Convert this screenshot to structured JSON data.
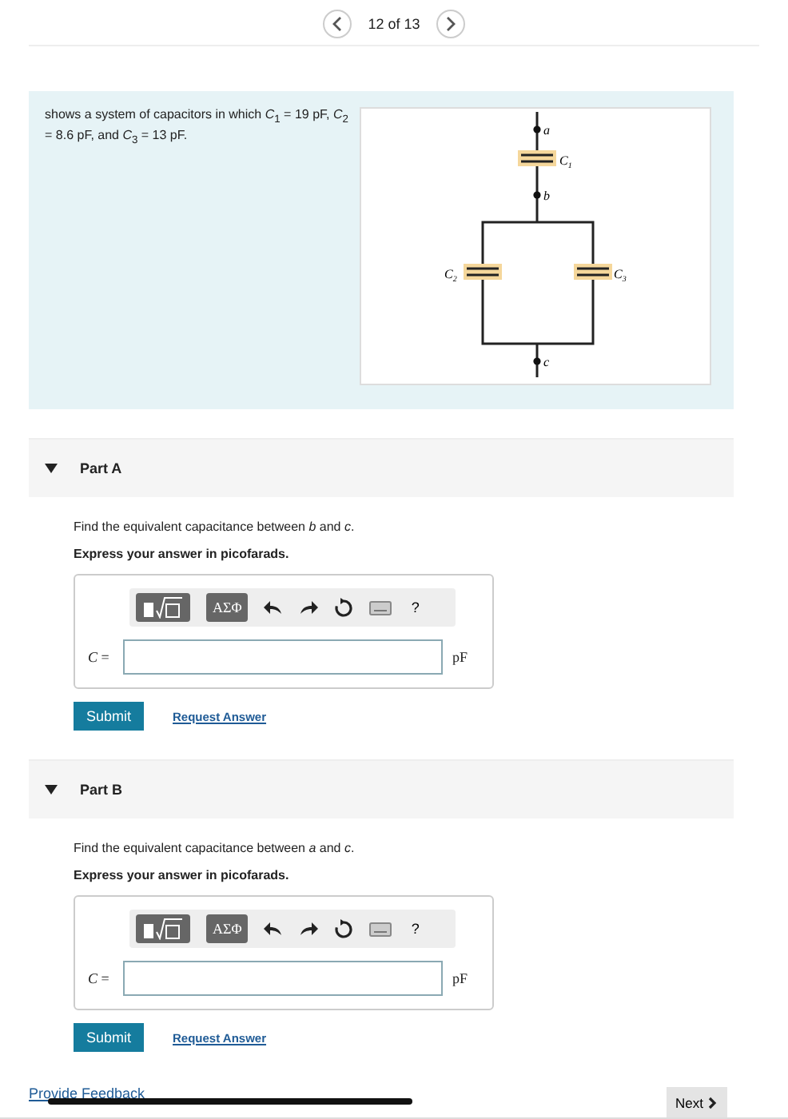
{
  "pager": {
    "label": "12 of 13"
  },
  "intro": {
    "text": "shows a system of capacitors in which *C*$_{1}$ = 19 pF, *C*$_{2}$ = 8.6 pF, and *C*$_{3}$ = 13 pF.",
    "circuit_labels": {
      "a": "a",
      "b": "b",
      "c": "c",
      "c1": "C",
      "c1_sub": "1",
      "c2": "C",
      "c2_sub": "2",
      "c3": "C",
      "c3_sub": "3"
    }
  },
  "parts": [
    {
      "title": "Part A",
      "expanded": true,
      "question": "Find the equivalent capacitance between *b* and *c*.",
      "instruction": "Express your answer in picofarads.",
      "toolbar": {
        "symbols": "ΑΣΦ",
        "help": "?"
      },
      "variable": "*C* =",
      "unit": "pF",
      "submit": "Submit",
      "request": "Request Answer"
    },
    {
      "title": "Part B",
      "expanded": true,
      "question": "Find the equivalent capacitance between *a* and *c*.",
      "instruction": "Express your answer in picofarads.",
      "toolbar": {
        "symbols": "ΑΣΦ",
        "help": "?"
      },
      "variable": "*C* =",
      "unit": "pF",
      "submit": "Submit",
      "request": "Request Answer"
    }
  ],
  "footer": {
    "feedback": "Provide Feedback",
    "next": "Next"
  }
}
